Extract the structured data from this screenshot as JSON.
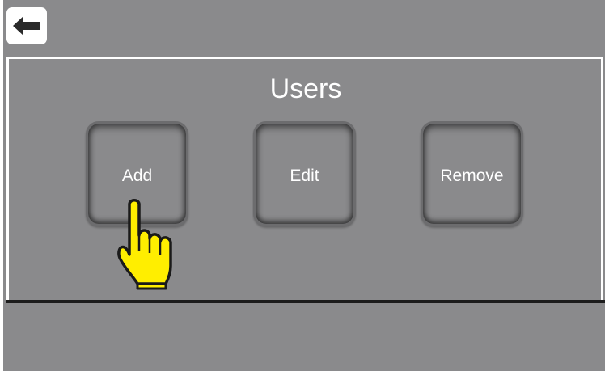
{
  "header": {
    "back_icon": "arrow-left-icon"
  },
  "page": {
    "title": "Users"
  },
  "actions": {
    "add_label": "Add",
    "edit_label": "Edit",
    "remove_label": "Remove"
  },
  "overlay": {
    "pointer_icon": "pointing-hand-icon",
    "pointer_color": "#ffee00"
  },
  "colors": {
    "background": "#8a8a8c",
    "text": "#ffffff"
  }
}
